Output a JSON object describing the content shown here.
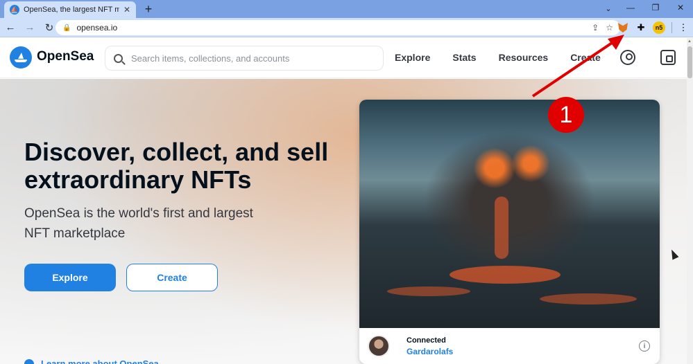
{
  "browser": {
    "tab_title": "OpenSea, the largest NFT marketplace",
    "favicon": "opensea-favicon",
    "url": "opensea.io"
  },
  "header": {
    "brand": "OpenSea",
    "search_placeholder": "Search items, collections, and accounts",
    "nav": [
      "Explore",
      "Stats",
      "Resources",
      "Create"
    ]
  },
  "hero": {
    "title": "Discover, collect, and sell extraordinary NFTs",
    "subtitle": "OpenSea is the world's first and largest NFT marketplace",
    "explore_label": "Explore",
    "create_label": "Create",
    "learn_more": "Learn more about OpenSea"
  },
  "featured": {
    "status": "Connected",
    "creator": "Gardarolafs"
  },
  "annotation": {
    "badge": "1"
  },
  "colors": {
    "accent": "#2081e2",
    "annotation": "#e00000"
  }
}
